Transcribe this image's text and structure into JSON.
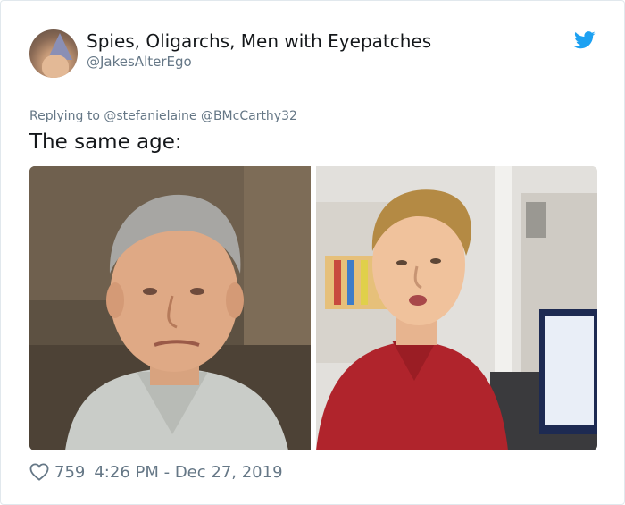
{
  "user": {
    "display_name": "Spies, Oligarchs, Men with Eyepatches",
    "handle": "@JakesAlterEgo"
  },
  "reply": {
    "text": "Replying to @stefanielaine @BMcCarthy32"
  },
  "tweet": {
    "text": "The same age:"
  },
  "media": {
    "left_photo": "photo-older-man-in-gray-shirt",
    "right_photo": "photo-young-man-in-red-polo"
  },
  "footer": {
    "likes": "759",
    "timestamp": "4:26 PM - Dec 27, 2019"
  },
  "colors": {
    "twitter_blue": "#1da1f2",
    "secondary_text": "#657786",
    "primary_text": "#14171a"
  },
  "icons": {
    "brand": "twitter-bird-icon",
    "like": "heart-outline-icon"
  }
}
